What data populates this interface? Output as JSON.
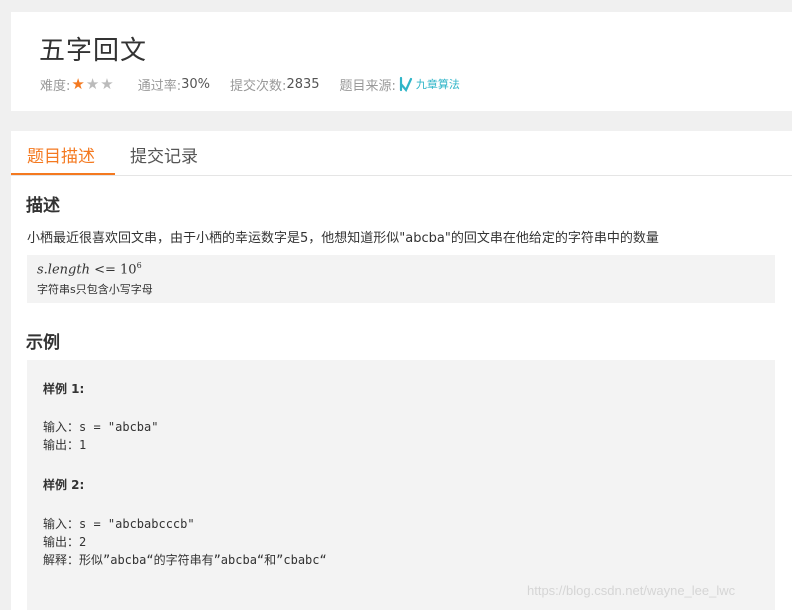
{
  "problem": {
    "title": "五字回文",
    "difficulty_label": "难度:",
    "difficulty_stars": 1,
    "difficulty_max": 3,
    "pass_rate_label": "通过率:",
    "pass_rate": "30%",
    "submissions_label": "提交次数:",
    "submissions": "2835",
    "source_label": "题目来源:",
    "source_name": "九章算法"
  },
  "tabs": [
    {
      "label": "题目描述",
      "active": true
    },
    {
      "label": "提交记录",
      "active": false
    }
  ],
  "description": {
    "heading": "描述",
    "text": "小栖最近很喜欢回文串，由于小栖的幸运数字是5，他想知道形似\"abcba\"的回文串在他给定的字符串中的数量",
    "constraint_var": "s.length",
    "constraint_op": "<=",
    "constraint_base": "10",
    "constraint_exp": "6",
    "constraint_note": "字符串s只包含小写字母"
  },
  "examples": {
    "heading": "示例",
    "items": [
      {
        "label": "样例 1:",
        "input": "输入：s = \"abcba\"",
        "output": "输出：1"
      },
      {
        "label": "样例 2:",
        "input": "输入：s = \"abcbabcccb\"",
        "output": "输出：2",
        "explanation": "解释：形似”abcba“的字符串有”abcba“和”cbabc“"
      }
    ]
  },
  "watermark": "https://blog.csdn.net/wayne_lee_lwc",
  "colors": {
    "accent": "#f47920",
    "star_off": "#bbbbbb",
    "source_logo": "#2fb5c8"
  }
}
